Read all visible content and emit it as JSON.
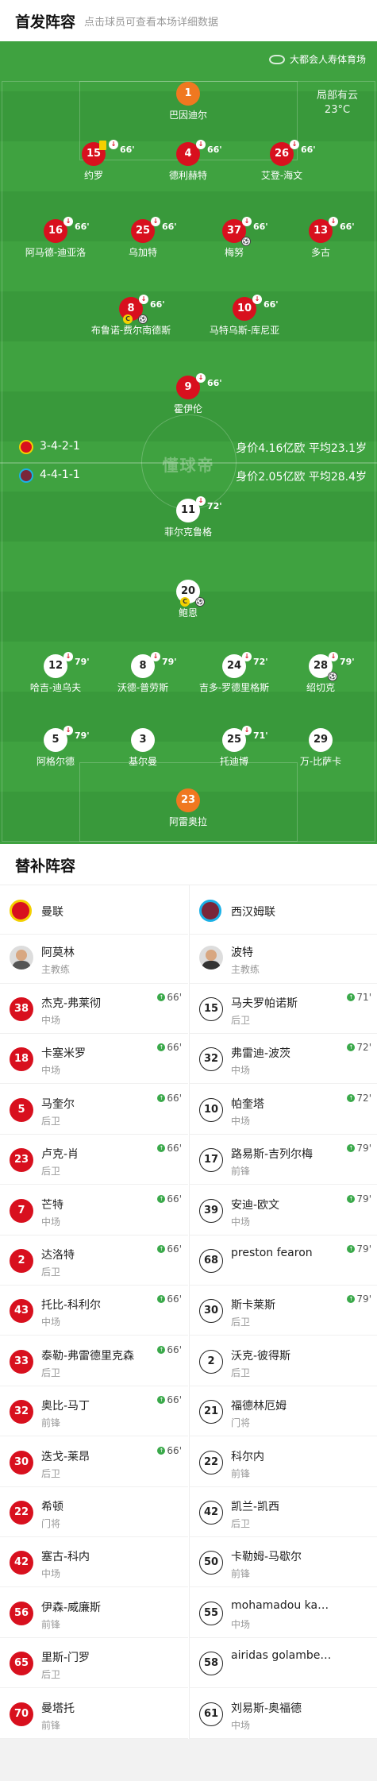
{
  "header": {
    "title": "首发阵容",
    "hint": "点击球员可查看本场详细数据"
  },
  "field": {
    "venue": "大都会人寿体育场",
    "weather": "局部有云",
    "temperature": "23°C",
    "watermark": "懂球帝",
    "home_formation": "3-4-2-1",
    "home_value": "身价4.16亿欧  平均23.1岁",
    "away_formation": "4-4-1-1",
    "away_value": "身价2.05亿欧  平均28.4岁"
  },
  "home_players": [
    {
      "num": "1",
      "name": "巴因迪尔",
      "gk": true
    },
    {
      "num": "15",
      "name": "约罗",
      "sub": "66'",
      "yellow": true
    },
    {
      "num": "4",
      "name": "德利赫特",
      "sub": "66'"
    },
    {
      "num": "26",
      "name": "艾登-海文",
      "sub": "66'"
    },
    {
      "num": "16",
      "name": "阿马德-迪亚洛",
      "sub": "66'"
    },
    {
      "num": "25",
      "name": "乌加特",
      "sub": "66'"
    },
    {
      "num": "37",
      "name": "梅努",
      "sub": "66'",
      "ball": true
    },
    {
      "num": "13",
      "name": "多古",
      "sub": "66'"
    },
    {
      "num": "8",
      "name": "布鲁诺-费尔南德斯",
      "sub": "66'",
      "captain": true,
      "ball": true
    },
    {
      "num": "10",
      "name": "马特乌斯-库尼亚",
      "sub": "66'"
    },
    {
      "num": "9",
      "name": "霍伊伦",
      "sub": "66'"
    }
  ],
  "away_players": [
    {
      "num": "11",
      "name": "菲尔克鲁格",
      "sub": "72'"
    },
    {
      "num": "20",
      "name": "鲍恩",
      "captain": true,
      "ball": true
    },
    {
      "num": "12",
      "name": "哈吉-迪乌夫",
      "sub": "79'"
    },
    {
      "num": "8",
      "name": "沃德-普劳斯",
      "sub": "79'"
    },
    {
      "num": "24",
      "name": "吉多-罗德里格斯",
      "sub": "72'"
    },
    {
      "num": "28",
      "name": "绍切克",
      "sub": "79'",
      "ball": true
    },
    {
      "num": "5",
      "name": "阿格尔德",
      "sub": "79'"
    },
    {
      "num": "3",
      "name": "基尔曼"
    },
    {
      "num": "25",
      "name": "托迪博",
      "sub": "71'"
    },
    {
      "num": "29",
      "name": "万-比萨卡"
    },
    {
      "num": "23",
      "name": "阿雷奥拉",
      "gk": true
    }
  ],
  "bench": {
    "title": "替补阵容",
    "home": {
      "team": "曼联",
      "coach": {
        "name": "阿莫林",
        "role": "主教练"
      },
      "players": [
        {
          "num": "38",
          "name": "杰克-弗莱彻",
          "pos": "中场",
          "time": "66'"
        },
        {
          "num": "18",
          "name": "卡塞米罗",
          "pos": "中场",
          "time": "66'"
        },
        {
          "num": "5",
          "name": "马奎尔",
          "pos": "后卫",
          "time": "66'"
        },
        {
          "num": "23",
          "name": "卢克-肖",
          "pos": "后卫",
          "time": "66'"
        },
        {
          "num": "7",
          "name": "芒特",
          "pos": "中场",
          "time": "66'"
        },
        {
          "num": "2",
          "name": "达洛特",
          "pos": "后卫",
          "time": "66'"
        },
        {
          "num": "43",
          "name": "托比-科利尔",
          "pos": "中场",
          "time": "66'"
        },
        {
          "num": "33",
          "name": "泰勒-弗雷德里克森",
          "pos": "后卫",
          "time": "66'"
        },
        {
          "num": "32",
          "name": "奥比-马丁",
          "pos": "前锋",
          "time": "66'"
        },
        {
          "num": "30",
          "name": "迭戈-莱昂",
          "pos": "后卫",
          "time": "66'"
        },
        {
          "num": "22",
          "name": "希顿",
          "pos": "门将",
          "time": ""
        },
        {
          "num": "42",
          "name": "塞古-科内",
          "pos": "中场",
          "time": ""
        },
        {
          "num": "56",
          "name": "伊森-威廉斯",
          "pos": "前锋",
          "time": ""
        },
        {
          "num": "65",
          "name": "里斯-门罗",
          "pos": "后卫",
          "time": ""
        },
        {
          "num": "70",
          "name": "曼塔托",
          "pos": "前锋",
          "time": ""
        }
      ]
    },
    "away": {
      "team": "西汉姆联",
      "coach": {
        "name": "波特",
        "role": "主教练"
      },
      "players": [
        {
          "num": "15",
          "name": "马夫罗帕诺斯",
          "pos": "后卫",
          "time": "71'"
        },
        {
          "num": "32",
          "name": "弗雷迪-波茨",
          "pos": "中场",
          "time": "72'"
        },
        {
          "num": "10",
          "name": "帕奎塔",
          "pos": "中场",
          "time": "72'"
        },
        {
          "num": "17",
          "name": "路易斯-吉列尔梅",
          "pos": "前锋",
          "time": "79'"
        },
        {
          "num": "39",
          "name": "安迪-欧文",
          "pos": "中场",
          "time": "79'"
        },
        {
          "num": "68",
          "name": "preston fearon",
          "pos": "",
          "time": "79'"
        },
        {
          "num": "30",
          "name": "斯卡莱斯",
          "pos": "后卫",
          "time": "79'"
        },
        {
          "num": "2",
          "name": "沃克-彼得斯",
          "pos": "后卫",
          "time": ""
        },
        {
          "num": "21",
          "name": "福德林厄姆",
          "pos": "门将",
          "time": ""
        },
        {
          "num": "22",
          "name": "科尔内",
          "pos": "前锋",
          "time": ""
        },
        {
          "num": "42",
          "name": "凯兰-凯西",
          "pos": "后卫",
          "time": ""
        },
        {
          "num": "50",
          "name": "卡勒姆-马歇尔",
          "pos": "前锋",
          "time": ""
        },
        {
          "num": "55",
          "name": "mohamadou kante",
          "pos": "中场",
          "time": ""
        },
        {
          "num": "58",
          "name": "airidas golambeckis",
          "pos": "",
          "time": ""
        },
        {
          "num": "61",
          "name": "刘易斯-奥福德",
          "pos": "中场",
          "time": ""
        }
      ]
    }
  },
  "colors": {
    "pitch": "#3fa240",
    "home": "#d8101e",
    "away": "#ffffff",
    "keeper": "#f07820"
  }
}
